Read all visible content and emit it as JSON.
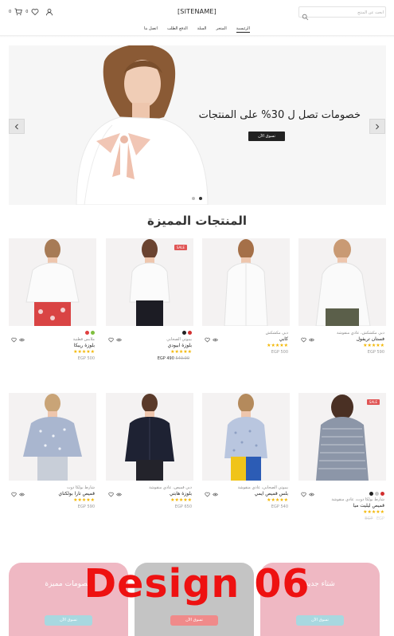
{
  "header": {
    "site_name": "[SITENAME]",
    "search_placeholder": "ابحث عن المنتج",
    "wishlist_count": "0",
    "cart_count": "0"
  },
  "nav": {
    "items": [
      {
        "label": "الرئيسية",
        "active": true
      },
      {
        "label": "المتجر",
        "active": false
      },
      {
        "label": "السلة",
        "active": false
      },
      {
        "label": "الدفع الطلب",
        "active": false
      },
      {
        "label": "اتصل بنا",
        "active": false
      }
    ]
  },
  "hero": {
    "title": "خصومات تصل ل 30% على المنتجات",
    "button": "تسوق الآن",
    "slides": 2,
    "active_slide": 2
  },
  "featured": {
    "title": "المنتجات المميزة",
    "products": [
      {
        "category": "دبي مكشكش، عادي منقوشة",
        "name": "فستان تريفول",
        "rating": 5,
        "price": "590 EGP",
        "sale": false
      },
      {
        "category": "دبي مكشكش",
        "name": "كابي",
        "rating": 5,
        "price": "500 EGP",
        "sale": false
      },
      {
        "category": "بيبوتي الصحابي",
        "name": "بلوزة ابيودي",
        "rating": 5,
        "price": "490 EGP",
        "old_price": "540.00",
        "sale": true,
        "sale_label": "SALE",
        "colors": [
          "#222222",
          "#d23030"
        ]
      },
      {
        "category": "ملابس قطنية",
        "name": "بلوزة ريبكا",
        "rating": 5,
        "price": "500 EGP",
        "sale": false,
        "colors": [
          "#e04040",
          "#7fbf3f"
        ]
      },
      {
        "category": "شارط بولكا دوت، عادي منقوشة",
        "name": "قميص ليليت ميا",
        "rating": 5,
        "price": "EGP",
        "old_price": "EGP",
        "sale": true,
        "sale_label": "SALE",
        "colors": [
          "#222222",
          "#c9c9c9",
          "#d23030"
        ]
      },
      {
        "category": "بيبوتي الصحابي، عادي منقوشة",
        "name": "بلس قميص ايمي",
        "rating": 5,
        "price": "540 EGP",
        "sale": false
      },
      {
        "category": "دبي قميص، عادي منقوشة",
        "name": "بلوزة هابتي",
        "rating": 5,
        "price": "650 EGP",
        "sale": false
      },
      {
        "category": "شارط بولكا دوت",
        "name": "قميص تارا بولكتاي",
        "rating": 5,
        "price": "590 EGP",
        "sale": false
      }
    ]
  },
  "banners": [
    {
      "title": "خصومات مميزة",
      "button": "تسوق الآن",
      "color": "#e8a0b0"
    },
    {
      "title": "",
      "button": "تسوق الآن",
      "color": "#b9b9b9"
    },
    {
      "title": "شتاء جديد",
      "button": "تسوق الآن",
      "color": "#e8a0b0"
    }
  ],
  "overlay": {
    "label": "Design 06",
    "color": "#ee1111"
  }
}
